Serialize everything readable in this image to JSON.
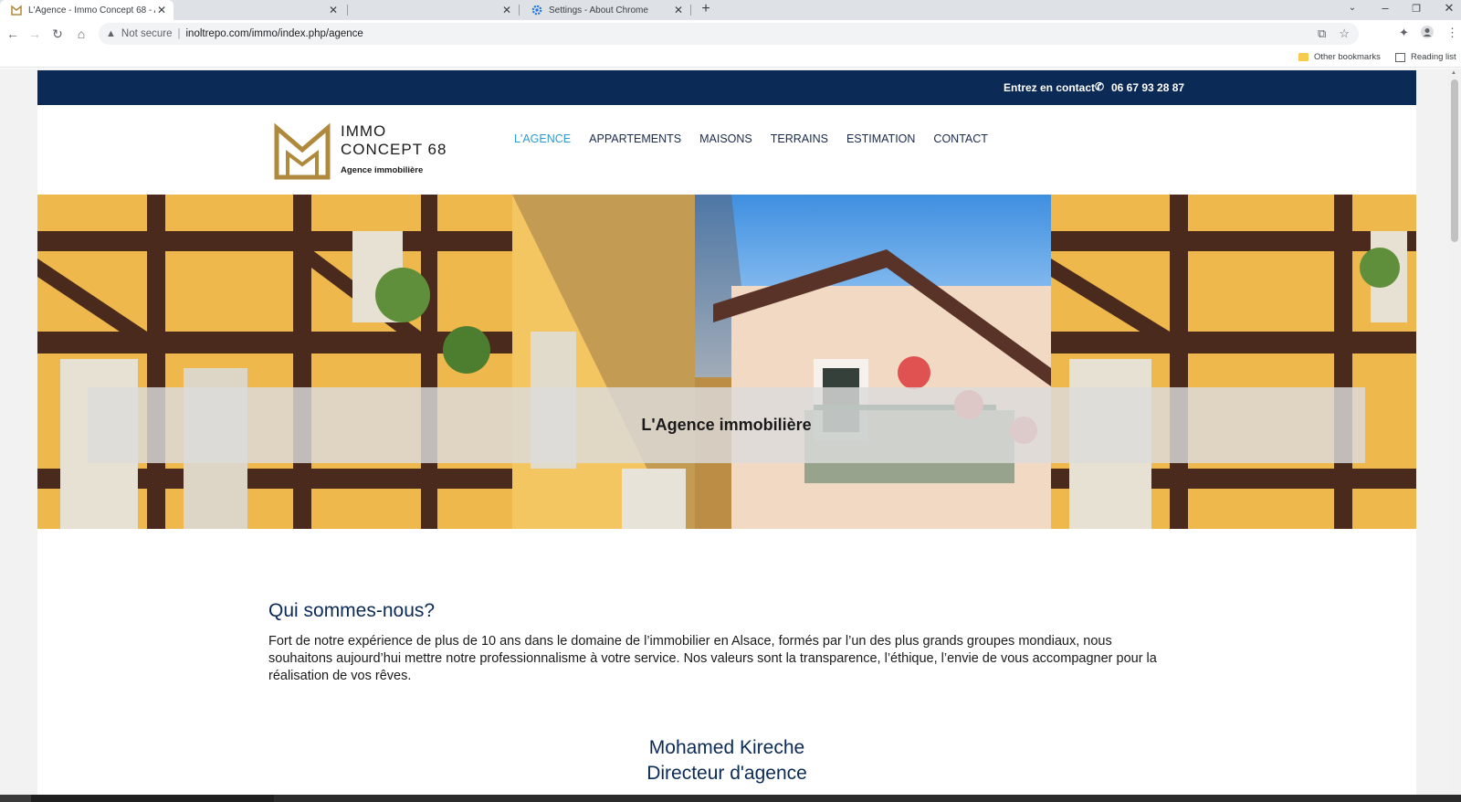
{
  "browser": {
    "tabs": [
      {
        "title": "L'Agence - Immo Concept 68 - A",
        "active": true
      },
      {
        "title": "",
        "active": false
      },
      {
        "title": "",
        "active": false
      },
      {
        "title": "Settings - About Chrome",
        "active": false
      }
    ],
    "new_tab": "+",
    "address": {
      "security_label": "Not secure",
      "url": "inoltrepo.com/immo/index.php/agence"
    },
    "bookmarks": {
      "other": "Other bookmarks",
      "reading_list": "Reading list"
    }
  },
  "site": {
    "topbar": {
      "contact_label": "Entrez en contact",
      "phone": "06 67 93 28 87"
    },
    "logo": {
      "line1": "IMMO",
      "line2": "CONCEPT 68",
      "tagline": "Agence immobilière",
      "color": "#b08a3c"
    },
    "nav": [
      {
        "label": "L'AGENCE",
        "active": true
      },
      {
        "label": "APPARTEMENTS",
        "active": false
      },
      {
        "label": "MAISONS",
        "active": false
      },
      {
        "label": "TERRAINS",
        "active": false
      },
      {
        "label": "ESTIMATION",
        "active": false
      },
      {
        "label": "CONTACT",
        "active": false
      }
    ],
    "hero": {
      "title": "L'Agence immobilière"
    },
    "about": {
      "heading": "Qui sommes-nous?",
      "text": "Fort de notre expérience de plus de 10 ans dans le domaine de l’immobilier en Alsace, formés par l’un des plus grands groupes mondiaux, nous souhaitons aujourd’hui mettre notre professionnalisme à votre service. Nos valeurs sont la transparence, l’éthique, l’envie de vous accompagner pour la réalisation de vos rêves."
    },
    "person": {
      "name": "Mohamed Kireche",
      "role": "Directeur d'agence"
    },
    "colors": {
      "primary_navy": "#0b2a55",
      "nav_active": "#2e9bd1",
      "gold": "#b08a3c"
    }
  }
}
